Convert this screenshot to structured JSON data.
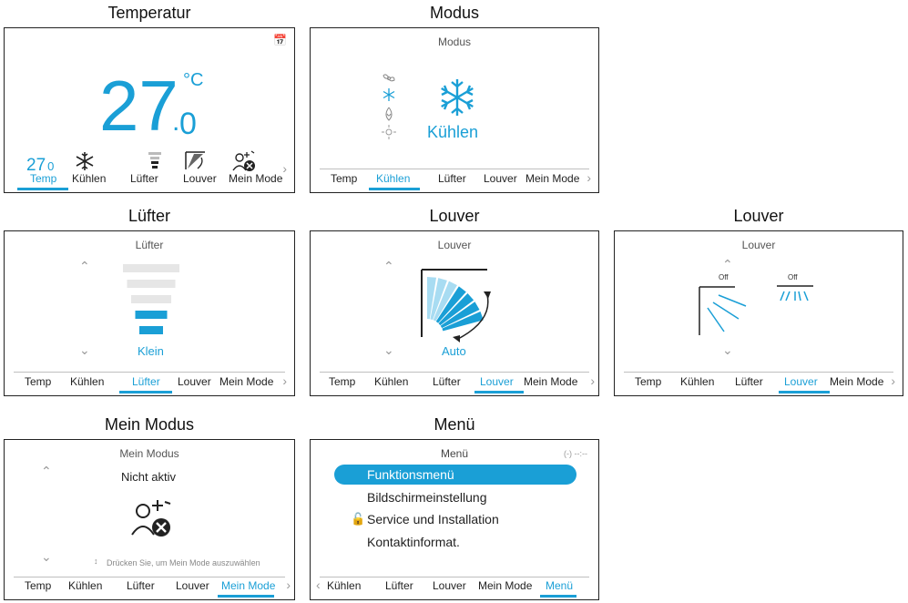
{
  "captions": {
    "temp": "Temperatur",
    "modus": "Modus",
    "luefter": "Lüfter",
    "louver1": "Louver",
    "louver2": "Louver",
    "meinmodus": "Mein Modus",
    "menu": "Menü"
  },
  "temp_panel": {
    "unit": "°C",
    "big_int": "27",
    "big_dec": "0",
    "tiles": [
      "27",
      "0"
    ],
    "nav": [
      "Temp",
      "Kühlen",
      "Lüfter",
      "Louver",
      "Mein Mode"
    ],
    "active": "Temp"
  },
  "modus_panel": {
    "title": "Modus",
    "selected": "Kühlen",
    "nav": [
      "Temp",
      "Kühlen",
      "Lüfter",
      "Louver",
      "Mein Mode"
    ],
    "active": "Kühlen"
  },
  "luefter_panel": {
    "title": "Lüfter",
    "level_label": "Klein",
    "level": 2,
    "levels_total": 5,
    "nav": [
      "Temp",
      "Kühlen",
      "Lüfter",
      "Louver",
      "Mein Mode"
    ],
    "active": "Lüfter"
  },
  "louver1_panel": {
    "title": "Louver",
    "value": "Auto",
    "nav": [
      "Temp",
      "Kühlen",
      "Lüfter",
      "Louver",
      "Mein Mode"
    ],
    "active": "Louver"
  },
  "louver2_panel": {
    "title": "Louver",
    "left_label": "Off",
    "right_label": "Off",
    "nav": [
      "Temp",
      "Kühlen",
      "Lüfter",
      "Louver",
      "Mein Mode"
    ],
    "active": "Louver"
  },
  "meinmodus_panel": {
    "title": "Mein Modus",
    "status": "Nicht aktiv",
    "hint": "Drücken Sie, um Mein Mode auszuwählen",
    "nav": [
      "Temp",
      "Kühlen",
      "Lüfter",
      "Louver",
      "Mein Mode"
    ],
    "active": "Mein Mode"
  },
  "menu_panel": {
    "title": "Menü",
    "clock": "(-) --:--",
    "items": [
      "Funktionsmenü",
      "Bildschirmeinstellung",
      "Service und Installation",
      "Kontaktinformat."
    ],
    "nav": [
      "Kühlen",
      "Lüfter",
      "Louver",
      "Mein Mode",
      "Menü"
    ],
    "active": "Menü"
  },
  "colors": {
    "accent": "#1a9fd6",
    "light_accent": "#a8dcf2",
    "inactive_bar": "#e6e6e6"
  }
}
